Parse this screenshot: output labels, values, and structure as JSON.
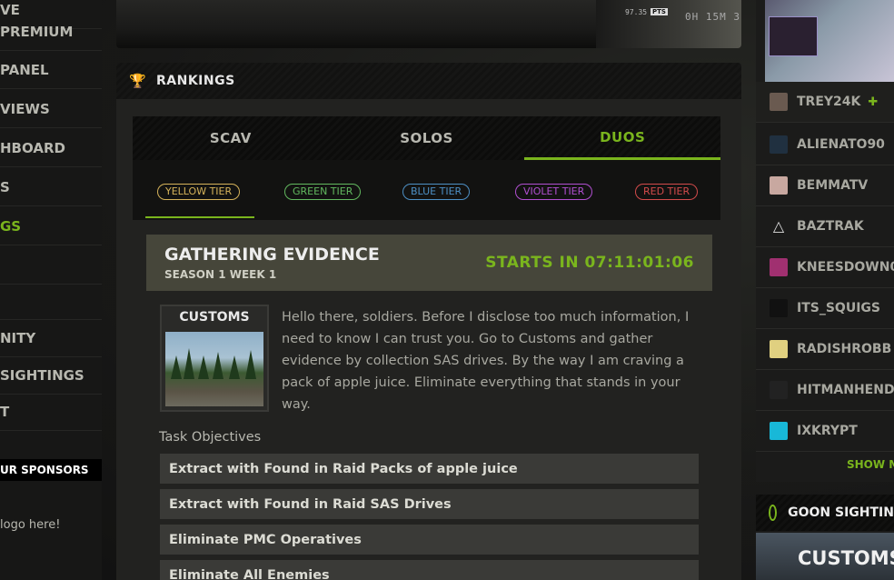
{
  "sidebar": {
    "items": [
      {
        "label": "VE"
      },
      {
        "label": "PREMIUM"
      },
      {
        "label": "PANEL"
      },
      {
        "label": "VIEWS"
      },
      {
        "label": "HBOARD"
      },
      {
        "label": "S"
      },
      {
        "label": "GS"
      },
      {
        "label": ""
      },
      {
        "label": ""
      },
      {
        "label": "NITY"
      },
      {
        "label": "SIGHTINGS"
      },
      {
        "label": "T"
      }
    ],
    "sponsors_heading": "UR SPONSORS",
    "sponsor_logo_text": "logo here!"
  },
  "video": {
    "points": "97.35",
    "points_badge": "PTS",
    "timer": "0H 15M 3"
  },
  "rankings": {
    "title": "RANKINGS",
    "mode_tabs": [
      {
        "label": "SCAV"
      },
      {
        "label": "SOLOS"
      },
      {
        "label": "DUOS"
      }
    ],
    "tiers": [
      {
        "label": "YELLOW TIER",
        "color": "#d4b25a"
      },
      {
        "label": "GREEN TIER",
        "color": "#62b85f"
      },
      {
        "label": "BLUE TIER",
        "color": "#4d8fc4"
      },
      {
        "label": "VIOLET TIER",
        "color": "#b04fd0"
      },
      {
        "label": "RED TIER",
        "color": "#d24b4b"
      }
    ],
    "task": {
      "title": "GATHERING EVIDENCE",
      "season": "SEASON 1 WEEK 1",
      "starts": "STARTS IN 07:11:01:06",
      "map": "CUSTOMS",
      "description": "Hello there, soldiers. Before I disclose too much information, I need to know I can trust you. Go to Customs and gather evidence by collection SAS drives. By the way I am craving a pack of apple juice. Eliminate everything that stands in your way.",
      "objectives_label": "Task Objectives",
      "objectives": [
        {
          "text": "Extract with Found in Raid Packs of apple juice"
        },
        {
          "text": "Extract with Found in Raid SAS Drives"
        },
        {
          "text": "Eliminate PMC Operatives"
        },
        {
          "text": "Eliminate All Enemies"
        }
      ]
    }
  },
  "streamers": {
    "list": [
      {
        "name": "TREY24K",
        "verified_icon": "shield-plus-icon"
      },
      {
        "name": "ALIENATO90"
      },
      {
        "name": "BEMMATV"
      },
      {
        "name": "BAZTRAK"
      },
      {
        "name": "KNEESDOWN08"
      },
      {
        "name": "ITS_SQUIGS"
      },
      {
        "name": "RADISHROBB"
      },
      {
        "name": "HITMANHENDRI"
      },
      {
        "name": "IXKRYPT"
      }
    ],
    "show_more": "SHOW M"
  },
  "goon": {
    "title": "GOON SIGHTIN",
    "map": "CUSTOMS"
  },
  "colors": {
    "accent": "#7ab51d"
  }
}
